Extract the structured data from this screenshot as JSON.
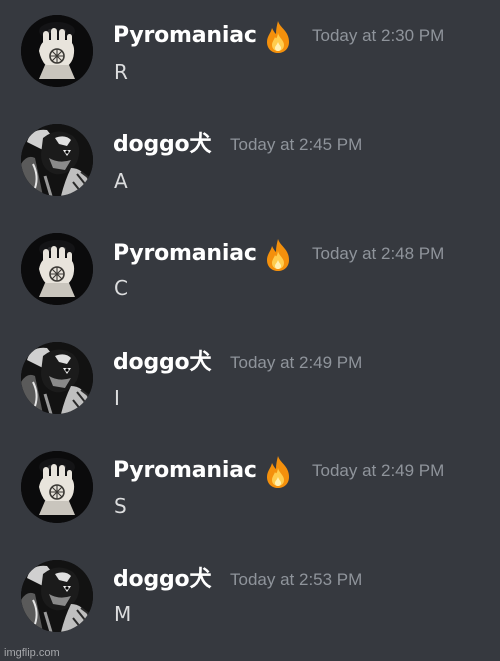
{
  "messages": [
    {
      "author": "Pyromaniac",
      "badge_icon": "fire-emoji",
      "timestamp": "Today at 2:30 PM",
      "content": "R",
      "avatar_icon": "pyromaniac-avatar-icon"
    },
    {
      "author": "doggo犬",
      "timestamp": "Today at 2:45 PM",
      "content": "A",
      "avatar_icon": "doggo-avatar-icon"
    },
    {
      "author": "Pyromaniac",
      "badge_icon": "fire-emoji",
      "timestamp": "Today at 2:48 PM",
      "content": "C",
      "avatar_icon": "pyromaniac-avatar-icon"
    },
    {
      "author": "doggo犬",
      "timestamp": "Today at 2:49 PM",
      "content": "I",
      "avatar_icon": "doggo-avatar-icon"
    },
    {
      "author": "Pyromaniac",
      "badge_icon": "fire-emoji",
      "timestamp": "Today at 2:49 PM",
      "content": "S",
      "avatar_icon": "pyromaniac-avatar-icon"
    },
    {
      "author": "doggo犬",
      "timestamp": "Today at 2:53 PM",
      "content": "M",
      "avatar_icon": "doggo-avatar-icon"
    }
  ],
  "watermark": "imgflip.com",
  "colors": {
    "background": "#36393f",
    "username": "#ffffff",
    "timestamp": "#8f949b",
    "content": "#dcddde"
  }
}
